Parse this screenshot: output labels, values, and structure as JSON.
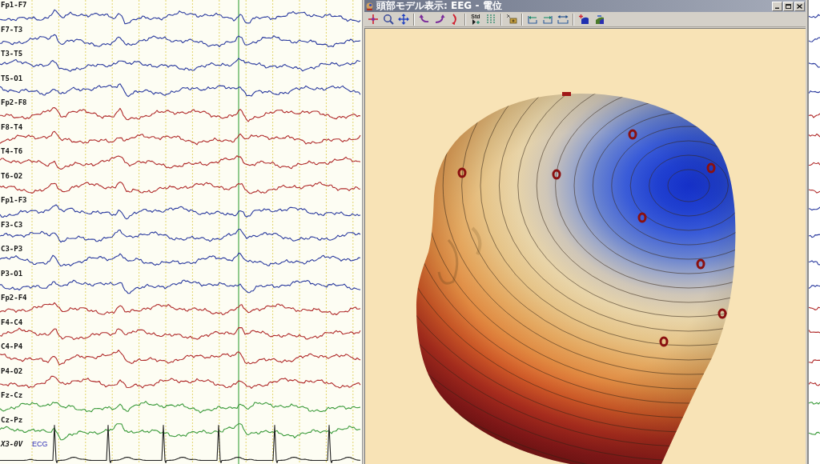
{
  "eeg_panel": {
    "channels": [
      {
        "kind": "eeg",
        "label": "Fp1-F7",
        "color": "#2a3a9e"
      },
      {
        "kind": "eeg",
        "label": "F7-T3",
        "color": "#2a3a9e"
      },
      {
        "kind": "eeg",
        "label": "T3-T5",
        "color": "#2a3a9e"
      },
      {
        "kind": "eeg",
        "label": "T5-O1",
        "color": "#2a3a9e"
      },
      {
        "kind": "eeg",
        "label": "Fp2-F8",
        "color": "#b02a2a"
      },
      {
        "kind": "eeg",
        "label": "F8-T4",
        "color": "#b02a2a"
      },
      {
        "kind": "eeg",
        "label": "T4-T6",
        "color": "#b02a2a"
      },
      {
        "kind": "eeg",
        "label": "T6-O2",
        "color": "#b02a2a"
      },
      {
        "kind": "eeg",
        "label": "Fp1-F3",
        "color": "#2a3a9e"
      },
      {
        "kind": "eeg",
        "label": "F3-C3",
        "color": "#2a3a9e"
      },
      {
        "kind": "eeg",
        "label": "C3-P3",
        "color": "#2a3a9e"
      },
      {
        "kind": "eeg",
        "label": "P3-O1",
        "color": "#2a3a9e"
      },
      {
        "kind": "eeg",
        "label": "Fp2-F4",
        "color": "#b02a2a"
      },
      {
        "kind": "eeg",
        "label": "F4-C4",
        "color": "#b02a2a"
      },
      {
        "kind": "eeg",
        "label": "C4-P4",
        "color": "#b02a2a"
      },
      {
        "kind": "eeg",
        "label": "P4-O2",
        "color": "#b02a2a"
      },
      {
        "kind": "eeg",
        "label": "Fz-Cz",
        "color": "#3a9a3a"
      },
      {
        "kind": "eeg",
        "label": "Cz-Pz",
        "color": "#3a9a3a"
      },
      {
        "kind": "ecg",
        "label": "X3-0V",
        "tag": "ECG",
        "color": "#222222"
      }
    ]
  },
  "head_window": {
    "title": "頭部モデル表示: EEG - 電位",
    "toolbar": [
      {
        "kind": "crosshair"
      },
      {
        "kind": "zoom"
      },
      {
        "kind": "move"
      },
      {
        "kind": "separator"
      },
      {
        "kind": "rotate_left"
      },
      {
        "kind": "rotate_right"
      },
      {
        "kind": "curve"
      },
      {
        "kind": "separator"
      },
      {
        "kind": "std",
        "label": "Std"
      },
      {
        "kind": "dots"
      },
      {
        "kind": "separator"
      },
      {
        "kind": "cube"
      },
      {
        "kind": "separator"
      },
      {
        "kind": "frame_left"
      },
      {
        "kind": "frame_right"
      },
      {
        "kind": "frame_both"
      },
      {
        "kind": "separator"
      },
      {
        "kind": "add_shape"
      },
      {
        "kind": "remove_shape"
      }
    ]
  }
}
